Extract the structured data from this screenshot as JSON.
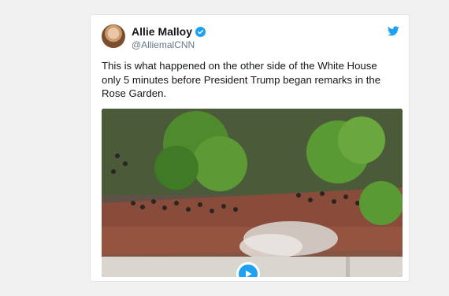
{
  "tweet": {
    "author_name": "Allie Malloy",
    "handle": "@AlliemalCNN",
    "text": "This is what happened on the other side of the White House only 5 minutes before President Trump began remarks in the Rose Garden.",
    "icons": {
      "verified": "verified-badge-icon",
      "brand": "twitter-bird-icon",
      "play": "play-icon"
    },
    "colors": {
      "accent": "#1da1f2",
      "name": "#14171a",
      "handle": "#657786"
    }
  }
}
